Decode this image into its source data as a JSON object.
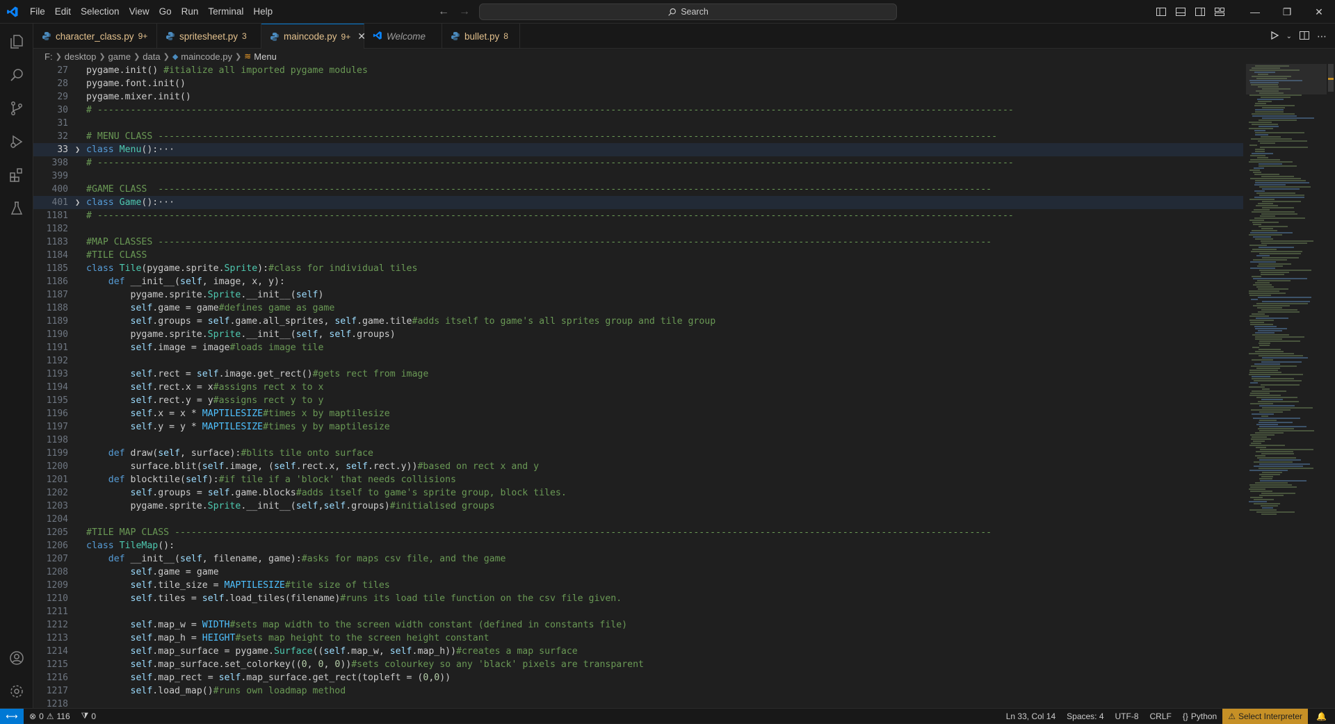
{
  "menu": [
    "File",
    "Edit",
    "Selection",
    "View",
    "Go",
    "Run",
    "Terminal",
    "Help"
  ],
  "search": {
    "label": "Search"
  },
  "tabs": [
    {
      "name": "character_class.py",
      "count": "9+"
    },
    {
      "name": "spritesheet.py",
      "count": "3"
    },
    {
      "name": "maincode.py",
      "count": "9+"
    },
    {
      "name": "Welcome",
      "count": ""
    },
    {
      "name": "bullet.py",
      "count": "8"
    }
  ],
  "breadcrumb": [
    "F:",
    "desktop",
    "game",
    "data",
    "maincode.py",
    "Menu"
  ],
  "code_lines": [
    {
      "ln": "27",
      "text": "pygame.init() #itialize all imported pygame modules"
    },
    {
      "ln": "28",
      "text": "pygame.font.init()"
    },
    {
      "ln": "29",
      "text": "pygame.mixer.init()"
    },
    {
      "ln": "30",
      "text": "# ----------------------------------------------------------------------------------------------------------------------------------------------------------------------"
    },
    {
      "ln": "31",
      "text": ""
    },
    {
      "ln": "32",
      "text": "# MENU CLASS --------------------------------------------------------------------------------------------------------------------------------------------------------"
    },
    {
      "ln": "33",
      "text": "class Menu():···"
    },
    {
      "ln": "398",
      "text": "# ----------------------------------------------------------------------------------------------------------------------------------------------------------------------"
    },
    {
      "ln": "399",
      "text": ""
    },
    {
      "ln": "400",
      "text": "#GAME CLASS  -------------------------------------------------------------------------------------------------------------------------------------------------------"
    },
    {
      "ln": "401",
      "text": "class Game():···"
    },
    {
      "ln": "1181",
      "text": "# ----------------------------------------------------------------------------------------------------------------------------------------------------------------------"
    },
    {
      "ln": "1182",
      "text": ""
    },
    {
      "ln": "1183",
      "text": "#MAP CLASSES -------------------------------------------------------------------------------------------------------------------------------------------------------"
    },
    {
      "ln": "1184",
      "text": "#TILE CLASS"
    },
    {
      "ln": "1185",
      "text": "class Tile(pygame.sprite.Sprite):#class for individual tiles"
    },
    {
      "ln": "1186",
      "text": "    def __init__(self, image, x, y):"
    },
    {
      "ln": "1187",
      "text": "        pygame.sprite.Sprite.__init__(self)"
    },
    {
      "ln": "1188",
      "text": "        self.game = game#defines game as game"
    },
    {
      "ln": "1189",
      "text": "        self.groups = self.game.all_sprites, self.game.tile#adds itself to game's all sprites group and tile group"
    },
    {
      "ln": "1190",
      "text": "        pygame.sprite.Sprite.__init__(self, self.groups)"
    },
    {
      "ln": "1191",
      "text": "        self.image = image#loads image tile"
    },
    {
      "ln": "1192",
      "text": ""
    },
    {
      "ln": "1193",
      "text": "        self.rect = self.image.get_rect()#gets rect from image"
    },
    {
      "ln": "1194",
      "text": "        self.rect.x = x#assigns rect x to x"
    },
    {
      "ln": "1195",
      "text": "        self.rect.y = y#assigns rect y to y"
    },
    {
      "ln": "1196",
      "text": "        self.x = x * MAPTILESIZE#times x by maptilesize"
    },
    {
      "ln": "1197",
      "text": "        self.y = y * MAPTILESIZE#times y by maptilesize"
    },
    {
      "ln": "1198",
      "text": ""
    },
    {
      "ln": "1199",
      "text": "    def draw(self, surface):#blits tile onto surface"
    },
    {
      "ln": "1200",
      "text": "        surface.blit(self.image, (self.rect.x, self.rect.y))#based on rect x and y"
    },
    {
      "ln": "1201",
      "text": "    def blocktile(self):#if tile if a 'block' that needs collisions"
    },
    {
      "ln": "1202",
      "text": "        self.groups = self.game.blocks#adds itself to game's sprite group, block tiles."
    },
    {
      "ln": "1203",
      "text": "        pygame.sprite.Sprite.__init__(self,self.groups)#initialised groups"
    },
    {
      "ln": "1204",
      "text": ""
    },
    {
      "ln": "1205",
      "text": "#TILE MAP CLASS ----------------------------------------------------------------------------------------------------------------------------------------------------"
    },
    {
      "ln": "1206",
      "text": "class TileMap():"
    },
    {
      "ln": "1207",
      "text": "    def __init__(self, filename, game):#asks for maps csv file, and the game"
    },
    {
      "ln": "1208",
      "text": "        self.game = game"
    },
    {
      "ln": "1209",
      "text": "        self.tile_size = MAPTILESIZE#tile size of tiles"
    },
    {
      "ln": "1210",
      "text": "        self.tiles = self.load_tiles(filename)#runs its load tile function on the csv file given."
    },
    {
      "ln": "1211",
      "text": ""
    },
    {
      "ln": "1212",
      "text": "        self.map_w = WIDTH#sets map width to the screen width constant (defined in constants file)"
    },
    {
      "ln": "1213",
      "text": "        self.map_h = HEIGHT#sets map height to the screen height constant"
    },
    {
      "ln": "1214",
      "text": "        self.map_surface = pygame.Surface((self.map_w, self.map_h))#creates a map surface"
    },
    {
      "ln": "1215",
      "text": "        self.map_surface.set_colorkey((0, 0, 0))#sets colourkey so any 'black' pixels are transparent"
    },
    {
      "ln": "1216",
      "text": "        self.map_rect = self.map_surface.get_rect(topleft = (0,0))"
    },
    {
      "ln": "1217",
      "text": "        self.load_map()#runs own loadmap method"
    },
    {
      "ln": "1218",
      "text": ""
    }
  ],
  "status": {
    "errors": "0",
    "warnings": "116",
    "ports": "0",
    "position": "Ln 33, Col 14",
    "spaces": "Spaces: 4",
    "encoding": "UTF-8",
    "eol": "CRLF",
    "language": "Python",
    "interpreter": "Select Interpreter"
  },
  "colors": {
    "accent": "#0078d4",
    "warning_bg": "#c69026",
    "modified_tab": "#e2c08d"
  }
}
